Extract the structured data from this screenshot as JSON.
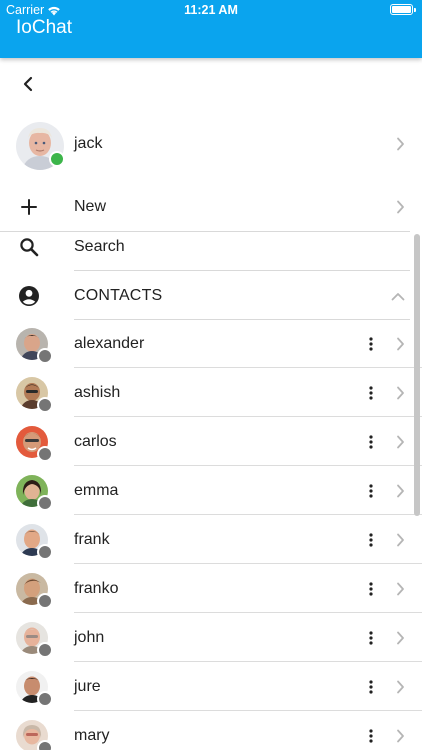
{
  "status_bar": {
    "carrier": "Carrier",
    "time": "11:21 AM"
  },
  "app": {
    "title": "IoChat"
  },
  "user": {
    "name": "jack",
    "status_color": "#3cb54a"
  },
  "menu": {
    "new_label": "New",
    "search_label": "Search",
    "contacts_label": "CONTACTS"
  },
  "contacts": [
    {
      "name": "alexander"
    },
    {
      "name": "ashish"
    },
    {
      "name": "carlos"
    },
    {
      "name": "emma"
    },
    {
      "name": "frank"
    },
    {
      "name": "franko"
    },
    {
      "name": "john"
    },
    {
      "name": "jure"
    },
    {
      "name": "mary"
    }
  ],
  "colors": {
    "header": "#0aa4ee",
    "offline_status": "#757575",
    "online_status": "#3cb54a"
  },
  "icons": [
    "wifi-icon",
    "battery-icon",
    "back-arrow-icon",
    "plus-icon",
    "search-icon",
    "account-circle-icon",
    "chevron-up-icon",
    "chevron-right-icon",
    "more-vert-icon"
  ]
}
